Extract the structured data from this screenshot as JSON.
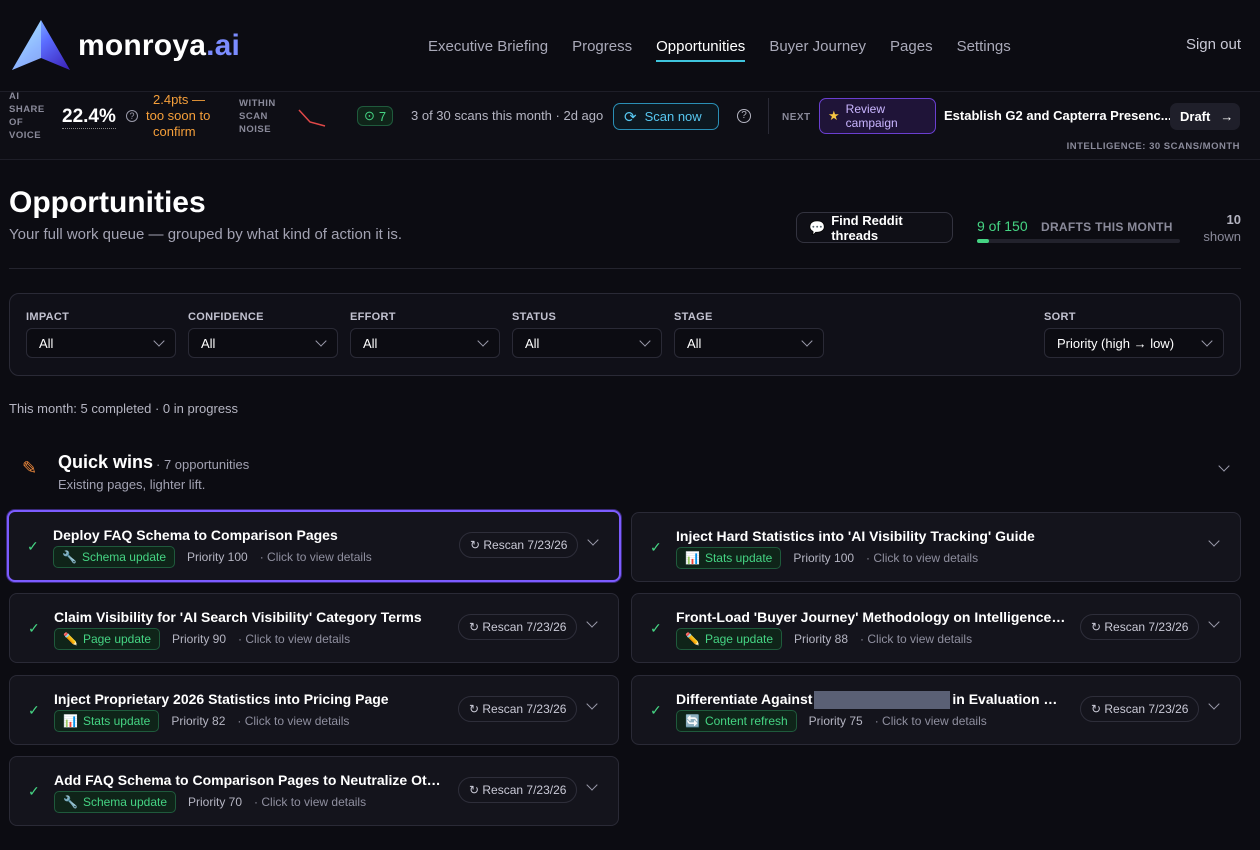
{
  "brand": {
    "name": "monroya",
    "suffix": ".ai"
  },
  "nav": {
    "items": [
      "Executive Briefing",
      "Progress",
      "Opportunities",
      "Buyer Journey",
      "Pages",
      "Settings"
    ],
    "active": "Opportunities",
    "signout": "Sign out"
  },
  "status": {
    "sov_label": [
      "AI",
      "SHARE",
      "OF",
      "VOICE"
    ],
    "sov_value": "22.4%",
    "delta": [
      "2.4pts —",
      "too soon to",
      "confirm"
    ],
    "noise": [
      "WITHIN",
      "SCAN",
      "NOISE"
    ],
    "count_badge": "7",
    "scans": "3 of 30 scans this month · 2d ago",
    "scan_button": "Scan now",
    "next_label": "NEXT",
    "review": [
      "Review",
      "campaign"
    ],
    "next_task": "Establish G2 and Capterra Presenc...",
    "draft_button": "Draft",
    "intelligence": "INTELLIGENCE: 30 SCANS/MONTH"
  },
  "header": {
    "title": "Opportunities",
    "subtitle": "Your full work queue — grouped by what kind of action it is.",
    "reddit_button": "Find Reddit threads",
    "drafts_count": "9 of 150",
    "drafts_label": "DRAFTS THIS MONTH",
    "drafts_progress": 0.06,
    "shown_count": "10",
    "shown_label": "shown"
  },
  "filters": [
    {
      "label": "IMPACT",
      "value": "All"
    },
    {
      "label": "CONFIDENCE",
      "value": "All"
    },
    {
      "label": "EFFORT",
      "value": "All"
    },
    {
      "label": "STATUS",
      "value": "All"
    },
    {
      "label": "STAGE",
      "value": "All"
    },
    {
      "label": "SORT",
      "value": "Priority (high → low)"
    }
  ],
  "month_summary": "This month: 5 completed · 0 in progress",
  "group": {
    "title": "Quick wins",
    "count": "· 7 opportunities",
    "desc": "Existing pages, lighter lift."
  },
  "cards": [
    {
      "title": "Deploy FAQ Schema to Comparison Pages",
      "tag": "Schema update",
      "tag_icon": "wrench-icon",
      "priority": "Priority 100",
      "hint": "· Click to view details",
      "rescan": "↻ Rescan 7/23/26"
    },
    {
      "title": "Inject Hard Statistics into 'AI Visibility Tracking' Guide",
      "tag": "Stats update",
      "tag_icon": "bar-chart-icon",
      "priority": "Priority 100",
      "hint": "· Click to view details",
      "rescan": ""
    },
    {
      "title": "Claim Visibility for 'AI Search Visibility' Category Terms",
      "tag": "Page update",
      "tag_icon": "pencil-icon",
      "priority": "Priority 90",
      "hint": "· Click to view details",
      "rescan": "↻ Rescan 7/23/26"
    },
    {
      "title": "Front-Load 'Buyer Journey' Methodology on Intelligence Pa...",
      "tag": "Page update",
      "tag_icon": "pencil-icon",
      "priority": "Priority 88",
      "hint": "· Click to view details",
      "rescan": "↻ Rescan 7/23/26"
    },
    {
      "title": "Inject Proprietary 2026 Statistics into Pricing Page",
      "tag": "Stats update",
      "tag_icon": "bar-chart-icon",
      "priority": "Priority 82",
      "hint": "· Click to view details",
      "rescan": "↻ Rescan 7/23/26"
    },
    {
      "title_a": "Differentiate Against",
      "title_b": "in Evaluation Co...",
      "tag": "Content refresh",
      "tag_icon": "refresh-icon",
      "priority": "Priority 75",
      "hint": "· Click to view details",
      "rescan": "↻ Rescan 7/23/26"
    },
    {
      "title": "Add FAQ Schema to Comparison Pages to Neutralize Otterly",
      "tag": "Schema update",
      "tag_icon": "wrench-icon",
      "priority": "Priority 70",
      "hint": "· Click to view details",
      "rescan": "↻ Rescan 7/23/26"
    }
  ]
}
